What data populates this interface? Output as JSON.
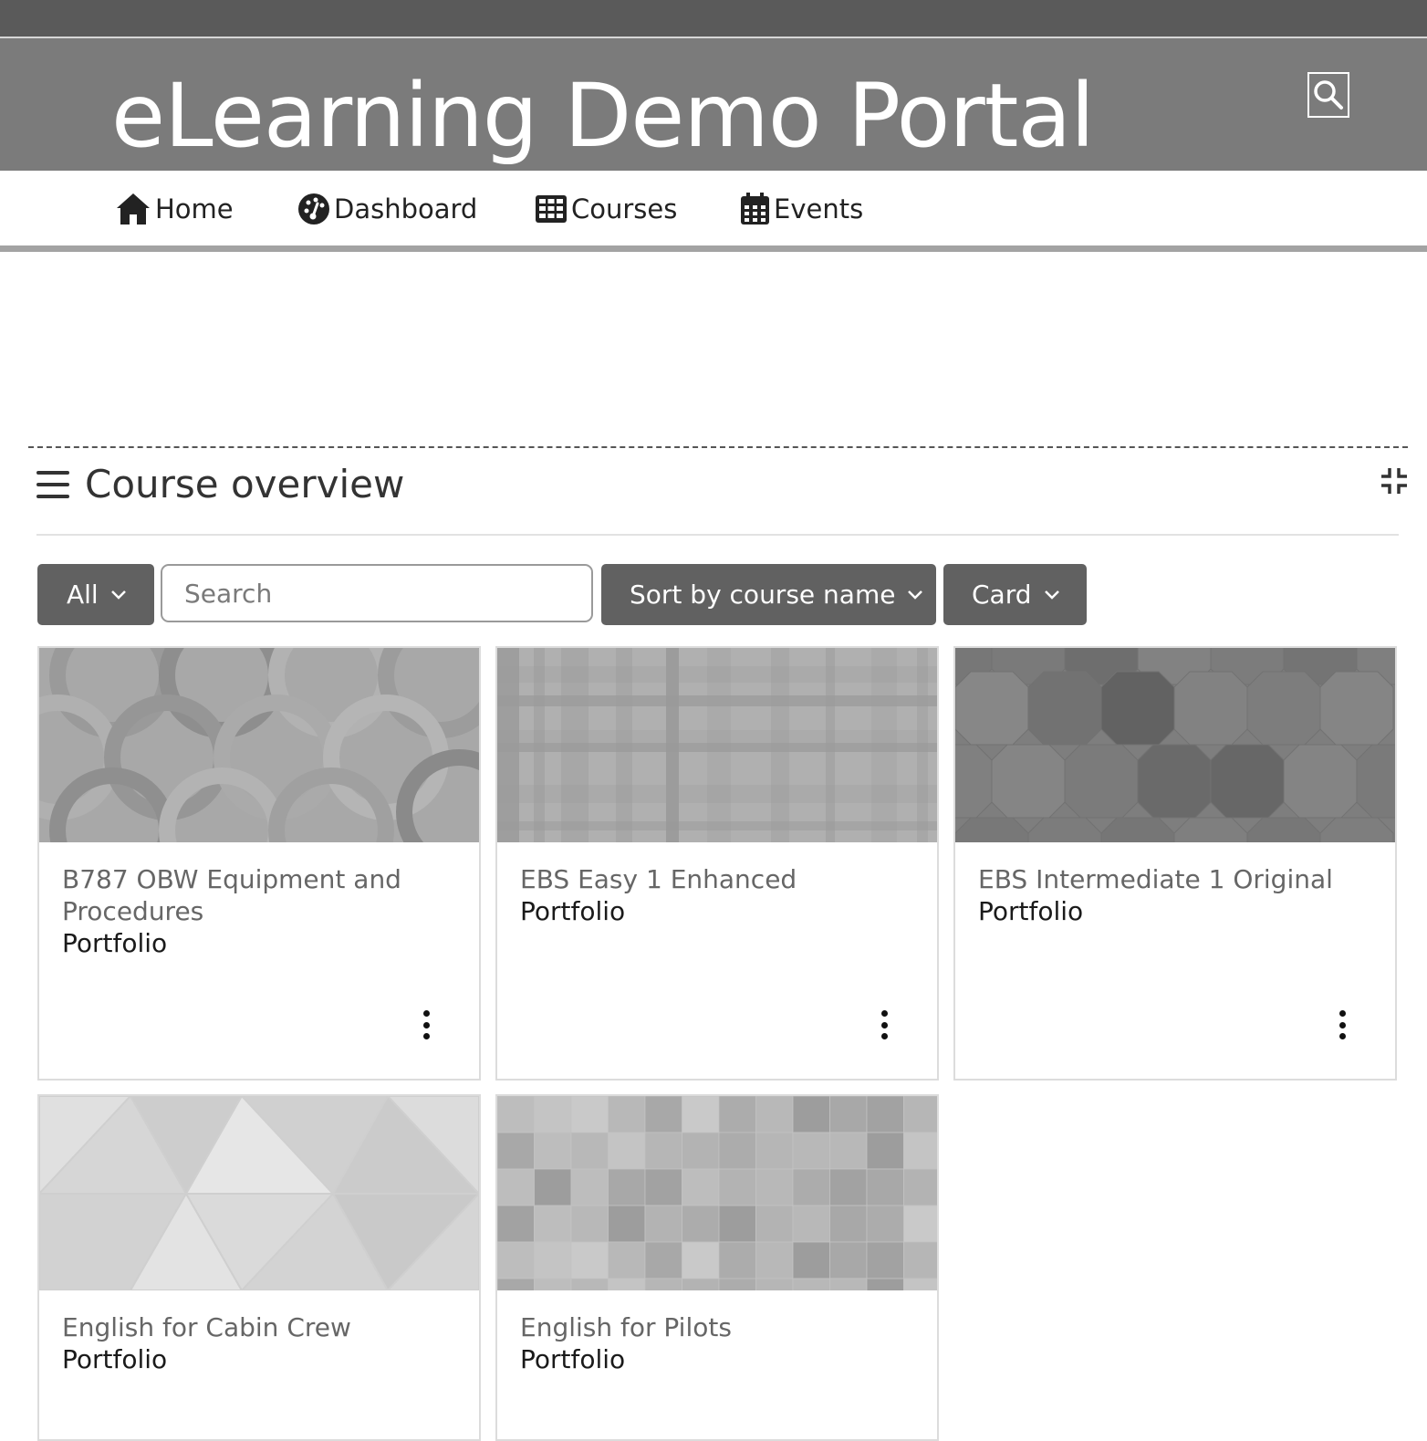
{
  "header": {
    "site_title": "eLearning Demo Portal",
    "search_icon": "search-icon"
  },
  "nav": {
    "items": [
      {
        "label": "Home",
        "icon": "home-icon"
      },
      {
        "label": "Dashboard",
        "icon": "dashboard-icon"
      },
      {
        "label": "Courses",
        "icon": "grid-icon"
      },
      {
        "label": "Events",
        "icon": "calendar-icon"
      }
    ]
  },
  "course_overview": {
    "title": "Course overview",
    "title_icon": "hamburger-icon",
    "collapse_icon": "collapse-icon",
    "filter": {
      "label": "All"
    },
    "search": {
      "placeholder": "Search",
      "value": ""
    },
    "sort": {
      "label": "Sort by course name"
    },
    "view": {
      "label": "Card"
    },
    "courses": [
      {
        "name": "B787 OBW Equipment and Procedures",
        "category": "Portfolio",
        "pattern": "circles"
      },
      {
        "name": "EBS Easy 1 Enhanced",
        "category": "Portfolio",
        "pattern": "plaid"
      },
      {
        "name": "EBS Intermediate 1 Original",
        "category": "Portfolio",
        "pattern": "octagons"
      },
      {
        "name": "English for Cabin Crew",
        "category": "Portfolio",
        "pattern": "triangles"
      },
      {
        "name": "English for Pilots",
        "category": "Portfolio",
        "pattern": "squares"
      }
    ]
  },
  "colors": {
    "top_strip": "#5a5a5a",
    "header_bg": "#7b7b7b",
    "button_bg": "#616161",
    "nav_underline": "#a3a3a3"
  }
}
